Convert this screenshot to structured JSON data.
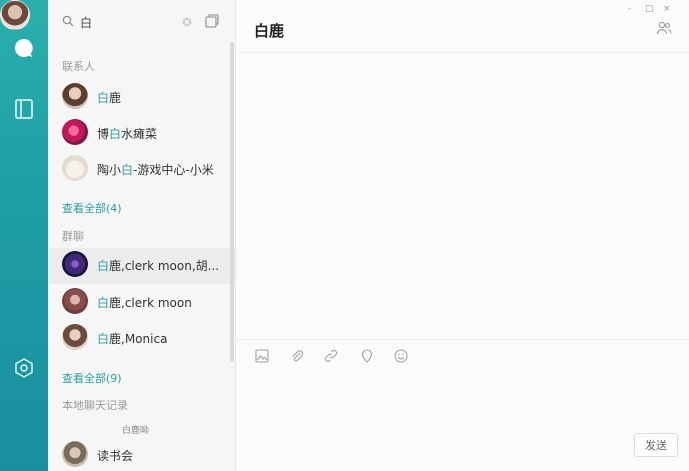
{
  "rail": {
    "icons": [
      "chat-icon",
      "book-icon",
      "settings-icon",
      "avatar"
    ]
  },
  "search": {
    "value": "白",
    "icons": [
      "search-icon",
      "clear-icon",
      "new-chat-icon"
    ]
  },
  "sections": {
    "contacts": {
      "title": "联系人",
      "items": [
        {
          "pre": "",
          "hl": "白",
          "post": "鹿"
        },
        {
          "pre": "博",
          "hl": "白",
          "post": "水瘫菜"
        },
        {
          "pre": "陶小",
          "hl": "白",
          "post": "-游戏中心-小米"
        }
      ],
      "more": "查看全部(4)"
    },
    "groups": {
      "title": "群聊",
      "items": [
        {
          "pre": "",
          "hl": "白",
          "post": "鹿,clerk moon,胡..."
        },
        {
          "pre": "",
          "hl": "白",
          "post": "鹿,clerk moon"
        },
        {
          "pre": "",
          "hl": "白",
          "post": "鹿,Monica"
        }
      ],
      "more": "查看全部(9)"
    },
    "local": {
      "title": "本地聊天记录",
      "tag": "白鹿呦",
      "items": [
        {
          "name": "读书会"
        }
      ]
    }
  },
  "main": {
    "title": "白鹿",
    "window_controls": [
      "-",
      "□",
      "×"
    ],
    "toolbar_icons": [
      "image-icon",
      "attachment-icon",
      "link-icon",
      "location-icon",
      "emoji-icon"
    ],
    "send_label": "发送"
  },
  "colors": {
    "accent": "#2d9ea0",
    "rail_top": "#2bb0ad",
    "rail_bottom": "#1a8fa0"
  }
}
